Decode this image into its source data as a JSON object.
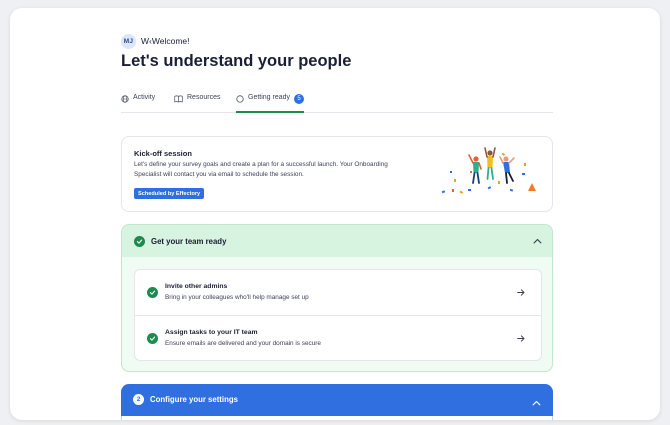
{
  "header": {
    "avatar_initials": "MJ",
    "welcome_text": "W‹Welcome!",
    "page_title": "Let's understand your people"
  },
  "tabs": [
    {
      "label": "Activity",
      "icon": "globe-icon",
      "active": false
    },
    {
      "label": "Resources",
      "icon": "book-icon",
      "active": false
    },
    {
      "label": "Getting ready",
      "icon": "circle-icon",
      "active": true,
      "badge": "5"
    }
  ],
  "kickoff": {
    "title": "Kick-off session",
    "description": "Let's define your survey goals and create a plan for a successful launch. Your Onboarding Specialist will contact you via email to schedule the session.",
    "badge": "Scheduled by Effectory",
    "illustration": "celebrating-people-illustration"
  },
  "team_section": {
    "title": "Get your team ready",
    "status": "complete",
    "tasks": [
      {
        "title": "Invite other admins",
        "description": "Bring in your colleagues who'll help manage set up",
        "status": "complete"
      },
      {
        "title": "Assign tasks to your IT team",
        "description": "Ensure emails are delivered and your domain is secure",
        "status": "complete"
      }
    ]
  },
  "configure_section": {
    "number": "2",
    "title": "Configure your settings"
  },
  "colors": {
    "accent_blue": "#2f6fe0",
    "success_green": "#1e8a4f",
    "section_green_bg": "#d6f4df"
  }
}
